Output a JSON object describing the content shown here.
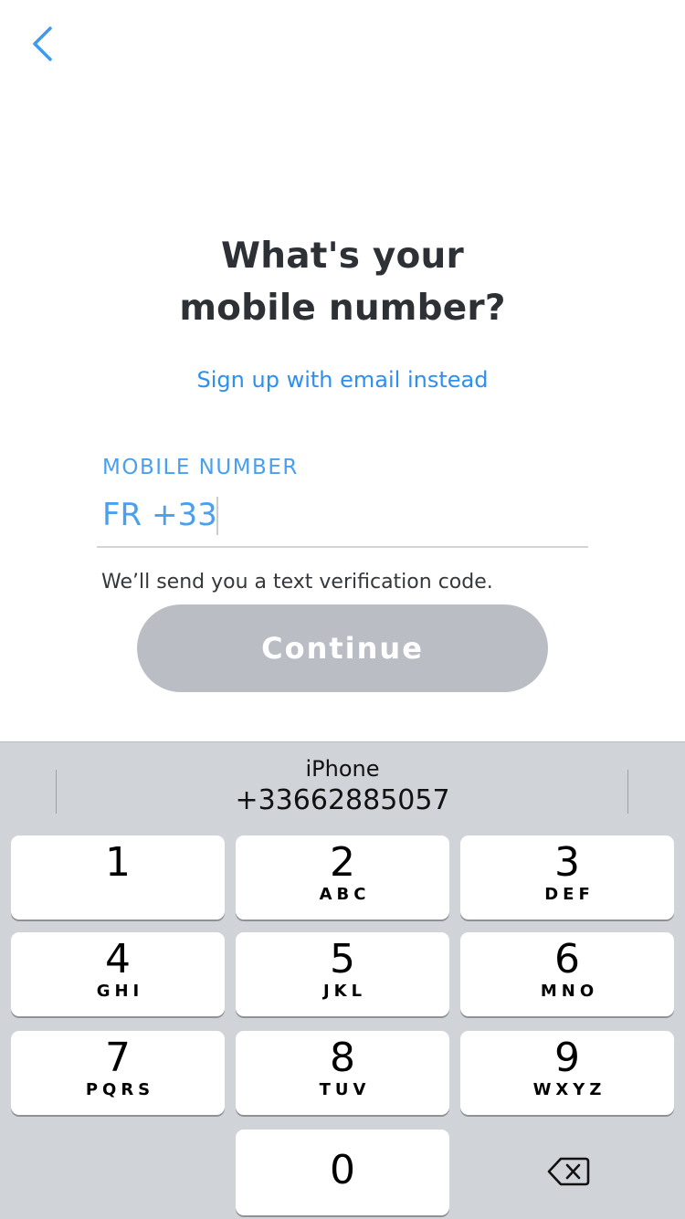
{
  "header": {
    "back_icon": "chevron-left-icon"
  },
  "title": {
    "line1": "What's your",
    "line2": "mobile number?"
  },
  "alt_link": "Sign up with email instead",
  "phone": {
    "label": "MOBILE NUMBER",
    "country_code": "FR +33",
    "value": ""
  },
  "helper_text": "We’ll send you a text verification code.",
  "continue_label": "Continue",
  "keyboard": {
    "suggestion": {
      "name": "iPhone",
      "number": "+33662885057"
    },
    "keys": [
      {
        "digit": "1",
        "letters": ""
      },
      {
        "digit": "2",
        "letters": "ABC"
      },
      {
        "digit": "3",
        "letters": "DEF"
      },
      {
        "digit": "4",
        "letters": "GHI"
      },
      {
        "digit": "5",
        "letters": "JKL"
      },
      {
        "digit": "6",
        "letters": "MNO"
      },
      {
        "digit": "7",
        "letters": "PQRS"
      },
      {
        "digit": "8",
        "letters": "TUV"
      },
      {
        "digit": "9",
        "letters": "WXYZ"
      },
      {
        "digit": "0",
        "letters": ""
      }
    ],
    "delete_icon": "backspace-icon"
  },
  "colors": {
    "accent": "#2d8ff0",
    "label_blue": "#4aa0ec",
    "title": "#2d3035",
    "button_disabled": "#babec4",
    "keyboard_bg": "#d0d3d8"
  }
}
